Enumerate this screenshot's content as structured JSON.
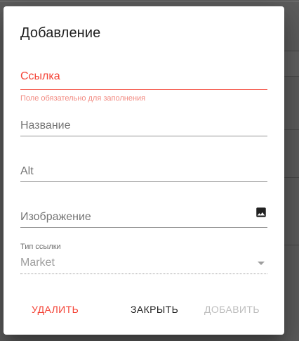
{
  "dialog": {
    "title": "Добавление"
  },
  "fields": {
    "link": {
      "label": "Ссылка",
      "value": "",
      "error": "Поле обязательно для заполнения"
    },
    "name": {
      "label": "Название",
      "value": ""
    },
    "alt": {
      "label": "Alt",
      "value": ""
    },
    "image": {
      "label": "Изображение",
      "value": "",
      "icon": "image-icon"
    },
    "link_type": {
      "label": "Тип ссылки",
      "selected": "Market"
    }
  },
  "actions": {
    "delete_label": "УДАЛИТЬ",
    "close_label": "ЗАКРЫТЬ",
    "add_label": "ДОБАВИТЬ"
  },
  "colors": {
    "error": "#f44336",
    "disabled": "#bdbdbd",
    "text": "#212121"
  }
}
